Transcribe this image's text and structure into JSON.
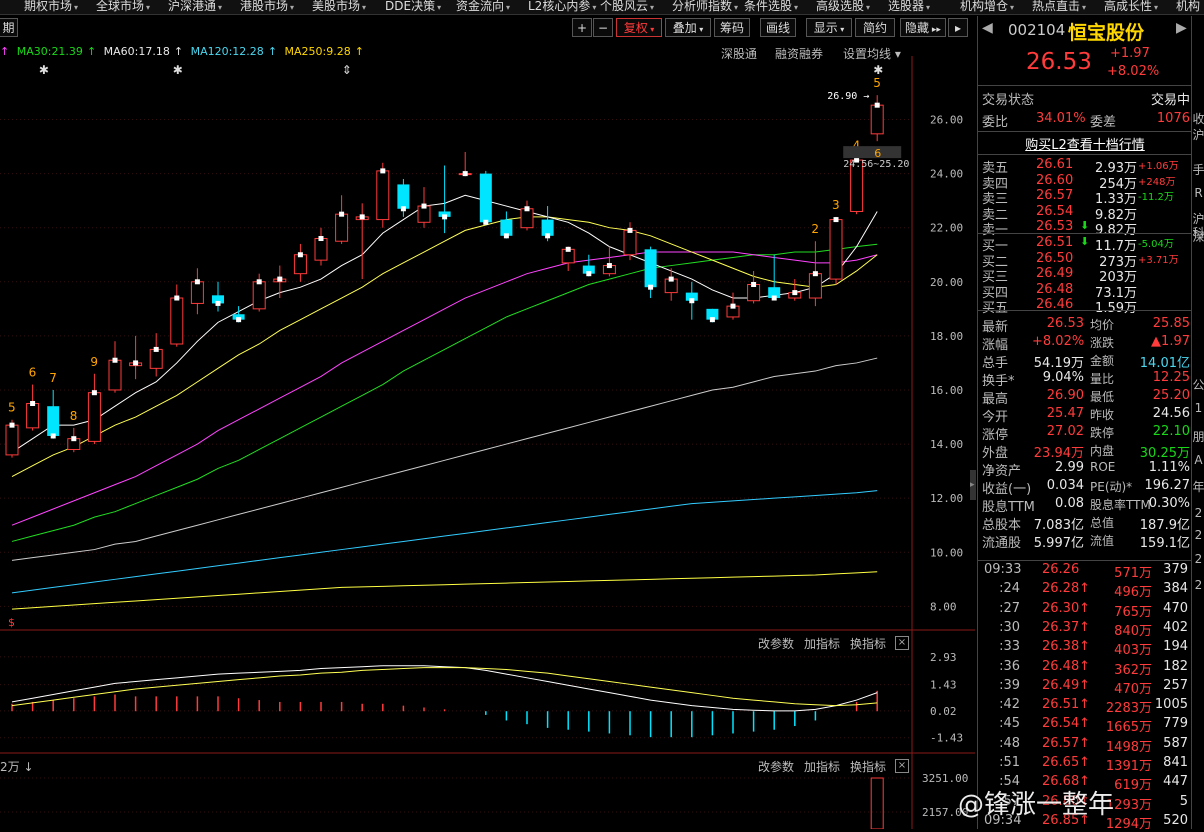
{
  "top_menu": [
    {
      "label": "期权市场"
    },
    {
      "label": "全球市场"
    },
    {
      "label": "沪深港通"
    },
    {
      "label": "港股市场"
    },
    {
      "label": "美股市场"
    },
    {
      "label": "DDE决策"
    },
    {
      "label": "资金流向"
    },
    {
      "label": "L2核心内参"
    },
    {
      "label": "个股风云"
    },
    {
      "label": "分析师指数"
    },
    {
      "label": "条件选股"
    },
    {
      "label": "高级选股"
    },
    {
      "label": "选股器"
    },
    {
      "label": "机构增仓"
    },
    {
      "label": "热点直击"
    },
    {
      "label": "高成长性"
    },
    {
      "label": "机构"
    }
  ],
  "toolbar": {
    "plus": "+",
    "minus": "−",
    "fuquan": "复权",
    "diejia": "叠加",
    "chouma": "筹码",
    "huaxian": "画线",
    "xianshi": "显示",
    "jianyue": "简约",
    "yincang": "隐藏",
    "period": "期"
  },
  "ma_line": {
    "ma30": "MA30:21.39",
    "ma60": "MA60:17.18",
    "ma120": "MA120:12.28",
    "ma250": "MA250:9.28"
  },
  "main_links": {
    "shengutong": "深股通",
    "rongzi": "融资融券",
    "shezhi": "设置均线"
  },
  "sub_links": {
    "gai": "改参数",
    "jia": "加指标",
    "huan": "换指标"
  },
  "vol_label": "2万",
  "colors": {
    "up": "#ff3b3b",
    "down": "#00e5ff",
    "ma5": "#ffffff",
    "ma10": "#ffff55",
    "ma20": "#ff44ff",
    "ma30": "#22dd22",
    "ma60": "#cccccc",
    "ma120": "#33ccff",
    "ma250": "#ffff44"
  },
  "chart_data": [
    {
      "type": "candlestick",
      "title": "",
      "ylim": [
        7.2,
        28.2
      ],
      "y_ticks": [
        "26.00",
        "24.00",
        "22.00",
        "20.00",
        "18.00",
        "16.00",
        "14.00",
        "12.00",
        "10.00",
        "8.00"
      ],
      "candles": [
        {
          "o": 13.6,
          "c": 14.7,
          "h": 14.9,
          "l": 13.5
        },
        {
          "o": 14.6,
          "c": 15.5,
          "h": 16.2,
          "l": 14.5
        },
        {
          "o": 15.4,
          "c": 14.3,
          "h": 16.0,
          "l": 14.2
        },
        {
          "o": 13.8,
          "c": 14.2,
          "h": 14.6,
          "l": 13.7
        },
        {
          "o": 14.1,
          "c": 15.9,
          "h": 16.6,
          "l": 14.0
        },
        {
          "o": 16.0,
          "c": 17.1,
          "h": 17.8,
          "l": 15.9
        },
        {
          "o": 16.9,
          "c": 17.0,
          "h": 18.0,
          "l": 16.4
        },
        {
          "o": 16.8,
          "c": 17.5,
          "h": 18.1,
          "l": 16.5
        },
        {
          "o": 17.7,
          "c": 19.4,
          "h": 19.9,
          "l": 17.6
        },
        {
          "o": 19.2,
          "c": 20.0,
          "h": 20.5,
          "l": 18.8
        },
        {
          "o": 19.5,
          "c": 19.2,
          "h": 20.0,
          "l": 18.9
        },
        {
          "o": 18.8,
          "c": 18.6,
          "h": 19.1,
          "l": 18.5
        },
        {
          "o": 19.0,
          "c": 20.0,
          "h": 20.3,
          "l": 18.9
        },
        {
          "o": 20.0,
          "c": 20.1,
          "h": 20.6,
          "l": 19.4
        },
        {
          "o": 20.3,
          "c": 21.0,
          "h": 21.4,
          "l": 20.0
        },
        {
          "o": 20.8,
          "c": 21.6,
          "h": 22.0,
          "l": 20.6
        },
        {
          "o": 21.5,
          "c": 22.5,
          "h": 23.2,
          "l": 21.4
        },
        {
          "o": 22.3,
          "c": 22.4,
          "h": 22.9,
          "l": 20.1
        },
        {
          "o": 22.3,
          "c": 24.1,
          "h": 24.4,
          "l": 22.0
        },
        {
          "o": 23.6,
          "c": 22.7,
          "h": 23.8,
          "l": 22.4
        },
        {
          "o": 22.2,
          "c": 22.8,
          "h": 23.5,
          "l": 22.0
        },
        {
          "o": 22.6,
          "c": 22.4,
          "h": 24.3,
          "l": 21.8
        },
        {
          "o": 24.0,
          "c": 24.0,
          "h": 24.8,
          "l": 23.9
        },
        {
          "o": 24.0,
          "c": 22.2,
          "h": 24.1,
          "l": 22.1
        },
        {
          "o": 22.3,
          "c": 21.7,
          "h": 22.6,
          "l": 21.6
        },
        {
          "o": 22.0,
          "c": 22.7,
          "h": 23.0,
          "l": 21.9
        },
        {
          "o": 22.3,
          "c": 21.7,
          "h": 22.8,
          "l": 21.5
        },
        {
          "o": 20.7,
          "c": 21.2,
          "h": 21.3,
          "l": 20.4
        },
        {
          "o": 20.6,
          "c": 20.3,
          "h": 21.0,
          "l": 20.2
        },
        {
          "o": 20.3,
          "c": 20.6,
          "h": 21.3,
          "l": 20.2
        },
        {
          "o": 21.0,
          "c": 21.9,
          "h": 22.2,
          "l": 20.8
        },
        {
          "o": 21.2,
          "c": 19.8,
          "h": 21.3,
          "l": 19.4
        },
        {
          "o": 19.6,
          "c": 20.1,
          "h": 20.5,
          "l": 19.3
        },
        {
          "o": 19.6,
          "c": 19.3,
          "h": 20.0,
          "l": 18.6
        },
        {
          "o": 19.0,
          "c": 18.6,
          "h": 19.0,
          "l": 18.5
        },
        {
          "o": 18.7,
          "c": 19.1,
          "h": 19.6,
          "l": 18.6
        },
        {
          "o": 19.3,
          "c": 19.9,
          "h": 20.4,
          "l": 19.2
        },
        {
          "o": 19.8,
          "c": 19.4,
          "h": 21.0,
          "l": 19.4
        },
        {
          "o": 19.4,
          "c": 19.6,
          "h": 20.1,
          "l": 19.3
        },
        {
          "o": 19.4,
          "c": 20.3,
          "h": 21.5,
          "l": 19.1
        },
        {
          "o": 20.1,
          "c": 22.3,
          "h": 22.4,
          "l": 19.9
        },
        {
          "o": 22.6,
          "c": 24.5,
          "h": 24.6,
          "l": 22.5
        },
        {
          "o": 25.47,
          "c": 26.53,
          "h": 26.9,
          "l": 25.2
        }
      ],
      "ma5": [
        13.7,
        14.2,
        14.7,
        14.7,
        14.9,
        15.4,
        15.9,
        16.3,
        17.0,
        17.8,
        18.5,
        18.9,
        19.3,
        19.6,
        19.8,
        20.1,
        20.6,
        21.0,
        21.8,
        22.3,
        22.8,
        22.9,
        23.2,
        23.0,
        22.8,
        22.6,
        22.4,
        22.2,
        21.8,
        21.3,
        21.0,
        20.7,
        20.4,
        20.1,
        19.7,
        19.4,
        19.4,
        19.5,
        19.6,
        19.8,
        20.3,
        21.3,
        22.6
      ],
      "ma10": [
        12.8,
        13.2,
        13.6,
        13.9,
        14.3,
        14.7,
        15.0,
        15.4,
        15.8,
        16.3,
        16.8,
        17.3,
        17.7,
        18.2,
        18.6,
        19.0,
        19.4,
        19.8,
        20.3,
        20.7,
        21.1,
        21.5,
        21.9,
        22.1,
        22.3,
        22.4,
        22.4,
        22.3,
        22.2,
        22.0,
        21.9,
        21.7,
        21.4,
        21.1,
        20.8,
        20.5,
        20.2,
        20.0,
        19.9,
        19.8,
        19.9,
        20.4,
        21.0
      ],
      "ma20": [
        11.0,
        11.3,
        11.6,
        11.9,
        12.2,
        12.5,
        12.8,
        13.2,
        13.6,
        14.0,
        14.5,
        14.9,
        15.3,
        15.7,
        16.1,
        16.5,
        17.0,
        17.4,
        17.8,
        18.2,
        18.6,
        19.0,
        19.4,
        19.7,
        20.0,
        20.3,
        20.5,
        20.7,
        20.8,
        20.9,
        21.0,
        21.1,
        21.1,
        21.1,
        21.1,
        21.1,
        21.0,
        20.9,
        20.8,
        20.7,
        20.7,
        20.8,
        21.0
      ],
      "ma30": [
        10.4,
        10.6,
        10.8,
        11.0,
        11.3,
        11.5,
        11.8,
        12.1,
        12.4,
        12.7,
        13.1,
        13.4,
        13.8,
        14.2,
        14.6,
        15.0,
        15.4,
        15.8,
        16.2,
        16.7,
        17.1,
        17.5,
        17.9,
        18.3,
        18.7,
        19.0,
        19.3,
        19.6,
        19.9,
        20.1,
        20.3,
        20.5,
        20.6,
        20.7,
        20.8,
        20.9,
        21.0,
        21.0,
        21.1,
        21.1,
        21.2,
        21.3,
        21.39
      ],
      "ma60": [
        9.7,
        9.8,
        9.9,
        10.0,
        10.1,
        10.3,
        10.4,
        10.6,
        10.8,
        11.0,
        11.2,
        11.4,
        11.6,
        11.8,
        12.0,
        12.2,
        12.4,
        12.6,
        12.8,
        13.0,
        13.2,
        13.4,
        13.6,
        13.8,
        14.0,
        14.2,
        14.4,
        14.6,
        14.8,
        15.0,
        15.2,
        15.4,
        15.6,
        15.8,
        16.0,
        16.1,
        16.3,
        16.5,
        16.6,
        16.7,
        16.9,
        17.0,
        17.18
      ],
      "ma120": [
        8.5,
        8.6,
        8.7,
        8.8,
        8.9,
        9.0,
        9.1,
        9.2,
        9.3,
        9.4,
        9.5,
        9.6,
        9.7,
        9.8,
        9.9,
        10.0,
        10.1,
        10.2,
        10.3,
        10.4,
        10.5,
        10.6,
        10.7,
        10.8,
        10.9,
        11.0,
        11.1,
        11.2,
        11.3,
        11.4,
        11.5,
        11.6,
        11.7,
        11.8,
        11.85,
        11.9,
        11.95,
        12.0,
        12.05,
        12.1,
        12.15,
        12.2,
        12.28
      ],
      "ma250": [
        7.9,
        7.95,
        8.0,
        8.05,
        8.1,
        8.15,
        8.2,
        8.25,
        8.3,
        8.35,
        8.4,
        8.45,
        8.5,
        8.55,
        8.6,
        8.65,
        8.7,
        8.72,
        8.74,
        8.76,
        8.78,
        8.8,
        8.82,
        8.84,
        8.86,
        8.88,
        8.9,
        8.92,
        8.94,
        8.96,
        8.98,
        9.0,
        9.02,
        9.04,
        9.06,
        9.08,
        9.1,
        9.12,
        9.14,
        9.16,
        9.2,
        9.24,
        9.28
      ],
      "markers": [
        {
          "idx": 0,
          "text": "5"
        },
        {
          "idx": 1,
          "text": "6"
        },
        {
          "idx": 2,
          "text": "7"
        },
        {
          "idx": 3,
          "text": "8"
        },
        {
          "idx": 4,
          "text": "9"
        },
        {
          "idx": 39,
          "text": "2"
        },
        {
          "idx": 40,
          "text": "3"
        },
        {
          "idx": 41,
          "text": "4"
        },
        {
          "idx": 42,
          "text": "5"
        }
      ],
      "high_label": "26.90",
      "low_label": "24.56~25.20",
      "marker_6": "6"
    },
    {
      "type": "line",
      "name": "macd",
      "y_ticks": [
        "2.93",
        "1.43",
        "0.02",
        "-1.43"
      ],
      "ylim": [
        -2.2,
        3.3
      ],
      "dif": [
        0.5,
        0.7,
        0.9,
        1.1,
        1.3,
        1.5,
        1.6,
        1.7,
        1.8,
        1.9,
        2.0,
        2.05,
        2.1,
        2.15,
        2.2,
        2.3,
        2.35,
        2.4,
        2.45,
        2.45,
        2.45,
        2.4,
        2.35,
        2.2,
        2.0,
        1.8,
        1.6,
        1.4,
        1.2,
        1.0,
        0.8,
        0.6,
        0.45,
        0.3,
        0.2,
        0.1,
        0.05,
        0.02,
        0.02,
        0.1,
        0.3,
        0.6,
        1.0
      ],
      "dea": [
        0.3,
        0.45,
        0.6,
        0.75,
        0.9,
        1.05,
        1.2,
        1.3,
        1.4,
        1.5,
        1.6,
        1.7,
        1.8,
        1.9,
        1.95,
        2.05,
        2.1,
        2.2,
        2.25,
        2.3,
        2.35,
        2.35,
        2.35,
        2.3,
        2.25,
        2.15,
        2.05,
        1.9,
        1.75,
        1.6,
        1.45,
        1.3,
        1.15,
        1.0,
        0.85,
        0.7,
        0.6,
        0.5,
        0.4,
        0.35,
        0.3,
        0.35,
        0.45
      ],
      "bars": [
        0.4,
        0.5,
        0.6,
        0.7,
        0.8,
        0.9,
        0.8,
        0.8,
        0.8,
        0.8,
        0.8,
        0.7,
        0.6,
        0.5,
        0.5,
        0.5,
        0.5,
        0.4,
        0.4,
        0.3,
        0.2,
        0.1,
        0.0,
        -0.2,
        -0.5,
        -0.7,
        -0.9,
        -1.0,
        -1.1,
        -1.2,
        -1.3,
        -1.4,
        -1.4,
        -1.4,
        -1.3,
        -1.2,
        -1.1,
        -1.0,
        -0.8,
        -0.5,
        0.0,
        0.5,
        1.1
      ]
    },
    {
      "type": "bar",
      "name": "volume",
      "y_ticks": [
        "3251.00",
        "2157.00"
      ]
    }
  ],
  "rp": {
    "code": "002104",
    "name": "恒宝股份",
    "price": "26.53",
    "chg": "+1.97",
    "pct": "+8.02%",
    "status_label": "交易状态",
    "status": "交易中",
    "weibi_l": "委比",
    "weibi": "34.01%",
    "weicha_l": "委差",
    "weicha": "1076",
    "buy_l2": "购买L2查看十档行情",
    "sells": [
      {
        "l": "卖五",
        "p": "26.61",
        "v": "2.93万",
        "d": "+1.06万"
      },
      {
        "l": "卖四",
        "p": "26.60",
        "v": "254万",
        "d": "+248万"
      },
      {
        "l": "卖三",
        "p": "26.57",
        "v": "1.33万",
        "d": "-11.2万"
      },
      {
        "l": "卖二",
        "p": "26.54",
        "v": "9.82万",
        "d": ""
      },
      {
        "l": "卖一",
        "p": "26.53",
        "v": "9.82万",
        "d": ""
      }
    ],
    "buys": [
      {
        "l": "买一",
        "p": "26.51",
        "v": "11.7万",
        "d": "-5.04万"
      },
      {
        "l": "买二",
        "p": "26.50",
        "v": "273万",
        "d": "+3.71万"
      },
      {
        "l": "买三",
        "p": "26.49",
        "v": "203万",
        "d": ""
      },
      {
        "l": "买四",
        "p": "26.48",
        "v": "73.1万",
        "d": ""
      },
      {
        "l": "买五",
        "p": "26.46",
        "v": "1.59万",
        "d": ""
      }
    ],
    "stats": [
      {
        "l1": "最新",
        "v1": "26.53",
        "l2": "均价",
        "v2": "25.85"
      },
      {
        "l1": "涨幅",
        "v1": "+8.02%",
        "l2": "涨跌",
        "v2": "▲1.97"
      },
      {
        "l1": "总手",
        "v1": "54.19万",
        "l2": "金额",
        "v2": "14.01亿"
      },
      {
        "l1": "换手*",
        "v1": "9.04%",
        "l2": "量比",
        "v2": "12.25"
      },
      {
        "l1": "最高",
        "v1": "26.90",
        "l2": "最低",
        "v2": "25.20"
      },
      {
        "l1": "今开",
        "v1": "25.47",
        "l2": "昨收",
        "v2": "24.56"
      },
      {
        "l1": "涨停",
        "v1": "27.02",
        "l2": "跌停",
        "v2": "22.10"
      },
      {
        "l1": "外盘",
        "v1": "23.94万",
        "l2": "内盘",
        "v2": "30.25万"
      },
      {
        "l1": "净资产",
        "v1": "2.99",
        "l2": "ROE",
        "v2": "1.11%"
      },
      {
        "l1": "收益(一)",
        "v1": "0.034",
        "l2": "PE(动)*",
        "v2": "196.27"
      },
      {
        "l1": "股息TTM",
        "v1": "0.08",
        "l2": "股息率TTM",
        "v2": "0.30%"
      },
      {
        "l1": "总股本",
        "v1": "7.083亿",
        "l2": "总值",
        "v2": "187.9亿"
      },
      {
        "l1": "流通股",
        "v1": "5.997亿",
        "l2": "流值",
        "v2": "159.1亿"
      }
    ],
    "ticks": [
      {
        "t": "09:33",
        "p": "26.26",
        "v": "571万",
        "n": "379"
      },
      {
        "t": ":24",
        "p": "26.28",
        "v": "496万",
        "n": "384"
      },
      {
        "t": ":27",
        "p": "26.30",
        "v": "765万",
        "n": "470"
      },
      {
        "t": ":30",
        "p": "26.37",
        "v": "840万",
        "n": "402"
      },
      {
        "t": ":33",
        "p": "26.38",
        "v": "403万",
        "n": "194"
      },
      {
        "t": ":36",
        "p": "26.48",
        "v": "362万",
        "n": "182"
      },
      {
        "t": ":39",
        "p": "26.49",
        "v": "470万",
        "n": "257"
      },
      {
        "t": ":42",
        "p": "26.51",
        "v": "2283万",
        "n": "1005"
      },
      {
        "t": ":45",
        "p": "26.54",
        "v": "1665万",
        "n": "779"
      },
      {
        "t": ":48",
        "p": "26.57",
        "v": "1498万",
        "n": "587"
      },
      {
        "t": ":51",
        "p": "26.65",
        "v": "1391万",
        "n": "841"
      },
      {
        "t": ":54",
        "p": "26.68",
        "v": "619万",
        "n": "447"
      },
      {
        "t": ":57",
        "p": "26.80",
        "v": "1293万",
        "n": "5"
      },
      {
        "t": "09:34",
        "p": "26.85",
        "v": "1294万",
        "n": "520"
      }
    ],
    "far_right": [
      "收",
      "沪",
      "手",
      "R",
      "沪",
      "深",
      "科",
      "公",
      "1",
      "朋",
      "A",
      "年",
      "2",
      "2",
      "2",
      "2"
    ]
  },
  "watermark": "@锋涨一整年"
}
